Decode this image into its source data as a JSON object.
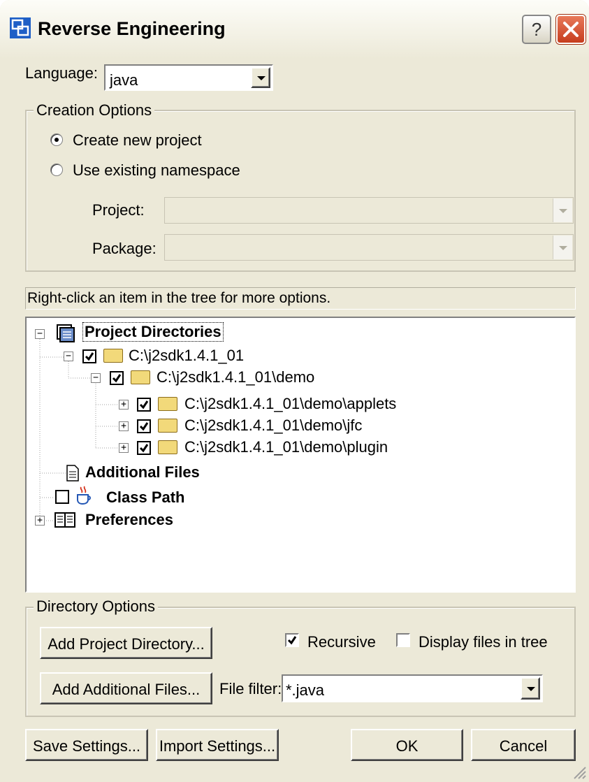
{
  "window": {
    "title": "Reverse Engineering"
  },
  "language": {
    "label": "Language:",
    "value": "java"
  },
  "creation_options": {
    "legend": "Creation Options",
    "radio_new": "Create new project",
    "radio_existing": "Use existing namespace",
    "project_label": "Project:",
    "package_label": "Package:"
  },
  "hint": "Right-click an item in the tree for more options.",
  "tree": {
    "root": "Project Directories",
    "dir1": "C:\\j2sdk1.4.1_01",
    "dir2": "C:\\j2sdk1.4.1_01\\demo",
    "dir3": "C:\\j2sdk1.4.1_01\\demo\\applets",
    "dir4": "C:\\j2sdk1.4.1_01\\demo\\jfc",
    "dir5": "C:\\j2sdk1.4.1_01\\demo\\plugin",
    "additional_files": "Additional Files",
    "class_path": "Class Path",
    "preferences": "Preferences"
  },
  "directory_options": {
    "legend": "Directory Options",
    "add_project_dir": "Add Project Directory...",
    "recursive": "Recursive",
    "display_files": "Display files in tree",
    "add_additional_files": "Add Additional Files...",
    "file_filter_label": "File filter:",
    "file_filter_value": "*.java"
  },
  "buttons": {
    "save_settings": "Save Settings...",
    "import_settings": "Import Settings...",
    "ok": "OK",
    "cancel": "Cancel"
  }
}
